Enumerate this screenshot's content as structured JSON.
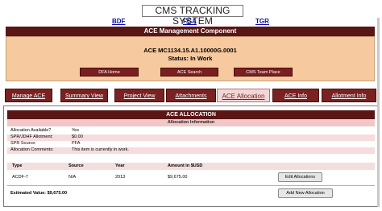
{
  "title": "CMS TRACKING SYSTEM",
  "top_links": [
    "BDF",
    "FGA",
    "TGR"
  ],
  "banner": "ACE Management Component",
  "ace": {
    "id": "ACE MC1134.15.A1.10000G.0001",
    "status": "Status: In Work"
  },
  "sub_buttons": [
    "DFA Home",
    "ACE Search",
    "CMS Team Place"
  ],
  "tabs": [
    "Manage ACE",
    "Summary View",
    "Project View",
    "Attachments",
    "ACE Allocation",
    "ACE Info",
    "Allotment Info"
  ],
  "active_tab": "ACE Allocation",
  "allocation": {
    "header": "ACE ALLOCATION",
    "subheader": "Allocation Information",
    "info": [
      {
        "label": "Allocation Available?",
        "value": "Yes"
      },
      {
        "label": "SPR/JDHF Allotment:",
        "value": "$0.00"
      },
      {
        "label": "SPR Source:",
        "value": "PFA"
      },
      {
        "label": "Allocation Comments:",
        "value": "This item is currently in work."
      }
    ],
    "columns": [
      "Type",
      "Source",
      "Year",
      "Amount in $USD"
    ],
    "rows": [
      {
        "type": "ACDF-7",
        "source": "N/A",
        "year": "2013",
        "amount": "$9,675.00"
      }
    ],
    "edit_button": "Edit Allocations",
    "add_button": "Add New Allocation",
    "estimated_label": "Estimated Value:",
    "estimated_value": "$9,675.00"
  }
}
